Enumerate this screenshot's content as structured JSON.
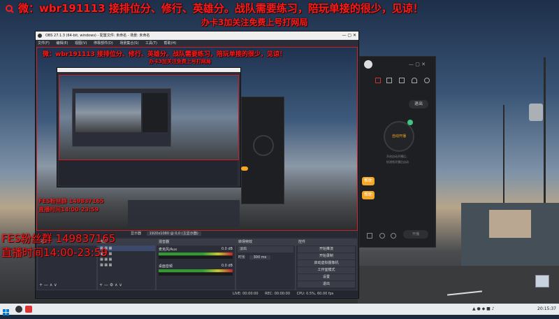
{
  "overlay": {
    "top_line": "微：wbr191113  接排位分、修行、英雄分。战队需要练习，陪玩单接的很少，见谅！",
    "sub_line": "办卡3加关注免费上号打网局",
    "fes": "FES粉丝群 149837165",
    "schedule": "直播时间14:00-23:59"
  },
  "obs": {
    "title": "OBS 27.1.3 (64-bit, windows) - 配置文件: 未命名 - 场景: 未命名",
    "menu": [
      "文件(F)",
      "编辑(E)",
      "视图(V)",
      "停靠部件(D)",
      "场景集合(S)",
      "工具(T)",
      "帮助(H)"
    ],
    "inner_top_line": "微：wbr191113  接排位分、修行、英雄分。战队需要练习，陪玩单接的很少，见谅！",
    "inner_sub_line": "办卡3加关注免费上号打网局",
    "inner_fes": "FES粉丝群 149837165",
    "inner_schedule": "直播时间14:00-23:59",
    "toolbar_label": "显示器",
    "toolbar_value": "1920x1080 @ 0,0 (主显示器)",
    "panels": {
      "scenes": "场景",
      "sources": "来源",
      "mixer": "混音器",
      "transitions": "转场特效",
      "controls": "控件"
    },
    "mixer": [
      {
        "name": "麦克风/Aux",
        "db": "0.0 dB"
      },
      {
        "name": "桌面音频",
        "db": "0.0 dB"
      }
    ],
    "transition": {
      "value": "淡出",
      "duration_label": "时长",
      "duration": "300 ms"
    },
    "controls": [
      "开始推流",
      "开始录制",
      "启动虚拟摄像机",
      "工作室模式",
      "设置",
      "退出"
    ],
    "status": {
      "live": "LIVE: 00:00:00",
      "rec": "REC: 00:00:00",
      "cpu": "CPU: 0.5%, 60.00 fps"
    }
  },
  "rapp": {
    "end_label": "退出",
    "circle_label": "自动开播",
    "desc_line1": "开启自动开播后，",
    "desc_line2": "检测到开播后自动",
    "help_btn1": "帮助",
    "help_btn2": "帮助",
    "bottom_btn": "开播"
  },
  "taskbar": {
    "time": "20:15:37"
  },
  "desktop_icon_label": "回收站",
  "colors": {
    "accent_orange": "#f5a623",
    "overlay_red": "#ff1a1a",
    "overlay_yellow": "#ffde00",
    "obs_bg": "#2b2e38",
    "preview_border": "#c8202a"
  }
}
